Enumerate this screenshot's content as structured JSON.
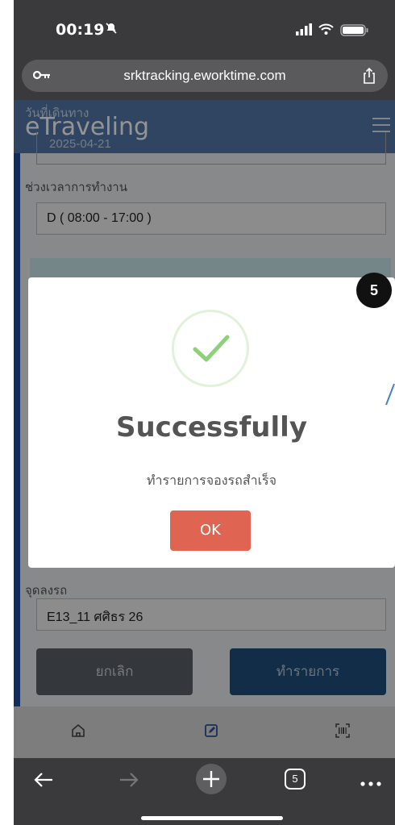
{
  "status": {
    "time": "00:19"
  },
  "browser": {
    "url": "srktracking.eworktime.com",
    "tab_count": "5"
  },
  "app": {
    "brand": "eTraveling"
  },
  "form": {
    "date_label": "วันที่เดินทาง",
    "date_value": "2025-04-21",
    "shift_label": "ช่วงเวลาการทำงาน",
    "shift_value": "D ( 08:00 - 17:00 )",
    "dropoff_label": "จุดลงรถ",
    "dropoff_value": "E13_11 ศศิธร 26",
    "cancel_label": "ยกเลิก",
    "submit_label": "ทำรายการ"
  },
  "modal": {
    "title": "Successfully",
    "message": "ทำรายการจองรถสำเร็จ",
    "ok_label": "OK"
  },
  "step_badge": "5"
}
